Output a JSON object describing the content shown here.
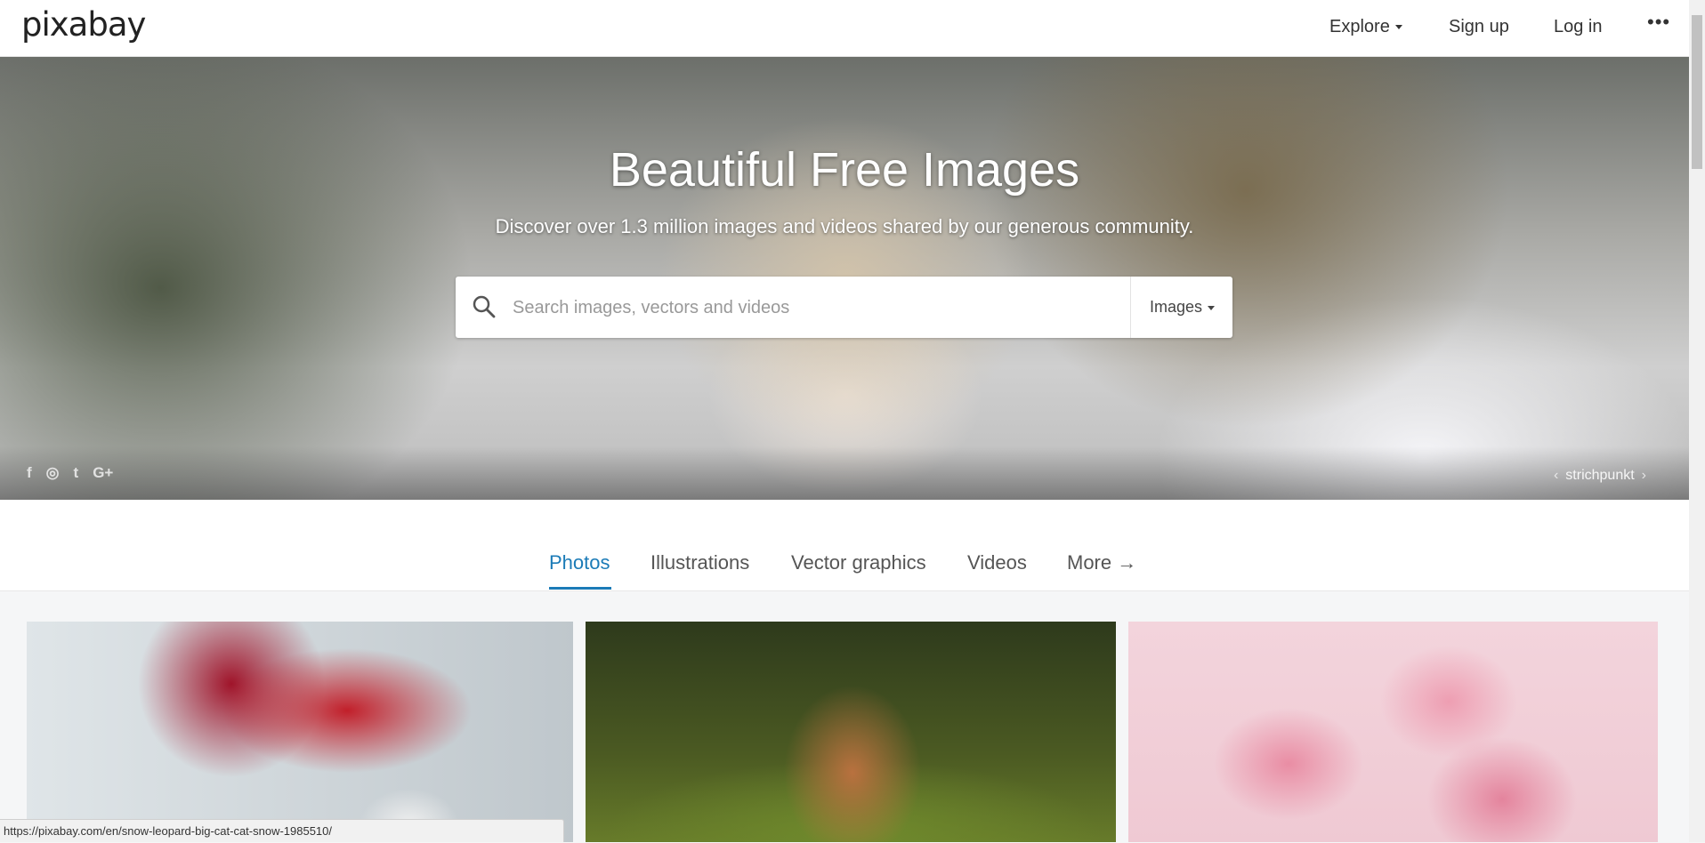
{
  "nav": {
    "logo": "pixabay",
    "explore": "Explore",
    "signup": "Sign up",
    "login": "Log in",
    "more": "•••"
  },
  "hero": {
    "title": "Beautiful Free Images",
    "subtitle": "Discover over 1.3 million images and videos shared by our generous community.",
    "search_placeholder": "Search images, vectors and videos",
    "search_type": "Images",
    "credit": "strichpunkt",
    "credit_prev": "‹",
    "credit_next": "›",
    "social": [
      "f",
      "◎",
      "t",
      "G+"
    ]
  },
  "tabs": [
    "Photos",
    "Illustrations",
    "Vector graphics",
    "Videos",
    "More →"
  ],
  "status_url": "https://pixabay.com/en/snow-leopard-big-cat-cat-snow-1985510/",
  "colors": {
    "accent": "#1b7bb7"
  }
}
